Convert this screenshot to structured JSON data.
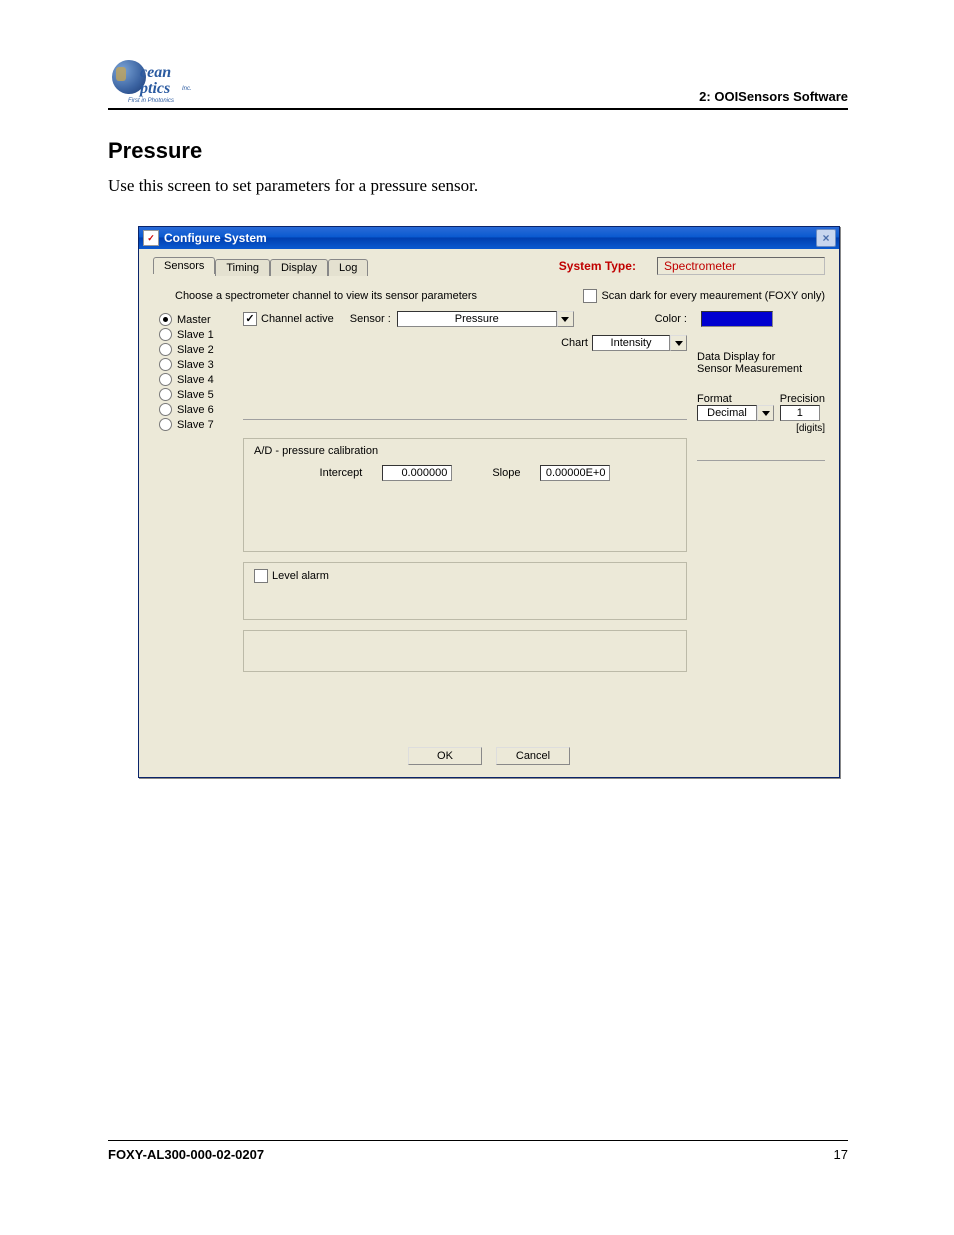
{
  "header": {
    "logo_line1": "cean",
    "logo_line2": "ptics",
    "logo_inc": "Inc.",
    "logo_tagline": "First in Photonics",
    "right": "2: OOISensors Software"
  },
  "section": {
    "title": "Pressure",
    "description": "Use this screen to set parameters for a pressure sensor."
  },
  "window": {
    "title": "Configure System",
    "close_glyph": "×",
    "tabs": [
      "Sensors",
      "Timing",
      "Display",
      "Log"
    ],
    "system_type_label": "System Type:",
    "system_type_value": "Spectrometer",
    "instruction": "Choose a spectrometer channel to view its sensor parameters",
    "scan_dark_label": "Scan dark for every meaurement (FOXY only)",
    "channels": [
      "Master",
      "Slave 1",
      "Slave 2",
      "Slave 3",
      "Slave 4",
      "Slave 5",
      "Slave 6",
      "Slave 7"
    ],
    "channel_active_label": "Channel active",
    "sensor_label": "Sensor :",
    "sensor_value": "Pressure",
    "color_label": "Color :",
    "chart_label": "Chart",
    "chart_value": "Intensity",
    "data_display_label1": "Data Display for",
    "data_display_label2": "Sensor Measurement",
    "format_label": "Format",
    "format_value": "Decimal",
    "precision_label": "Precision",
    "precision_value": "1",
    "digits_label": "[digits]",
    "calib_title": "A/D - pressure calibration",
    "intercept_label": "Intercept",
    "intercept_value": "0.000000",
    "slope_label": "Slope",
    "slope_value": "0.00000E+0",
    "level_alarm_label": "Level alarm",
    "ok_label": "OK",
    "cancel_label": "Cancel"
  },
  "footer": {
    "left": "FOXY-AL300-000-02-0207",
    "right": "17"
  }
}
